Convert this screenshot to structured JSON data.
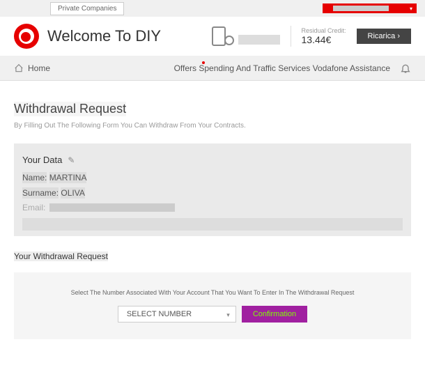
{
  "topbar": {
    "tab_label": "Private Companies"
  },
  "header": {
    "welcome_text": "Welcome To DIY",
    "welcome_shadow": "Welcome",
    "credit_label": "Residual Credit:",
    "credit_value": "13.44€",
    "ricarica_label": "Ricarica ›"
  },
  "nav": {
    "home": "Home",
    "links_text": "Offers Spending And Traffic Services Vodafone Assistance"
  },
  "page": {
    "title": "Withdrawal Request",
    "subtitle": "By Filling Out The Following Form You Can Withdraw From Your Contracts."
  },
  "yourdata": {
    "header": "Your Data",
    "name_label": "Name:",
    "name_value": "MARTINA",
    "surname_label": "Surname:",
    "surname_value": "OLIVA",
    "email_label": "Email:"
  },
  "request": {
    "section_title": "Your Withdrawal Request",
    "instruction": "Select The Number Associated With Your Account That You Want To Enter In The Withdrawal Request",
    "select_placeholder": "SELECT NUMBER",
    "confirm_label": "Confirmation"
  }
}
